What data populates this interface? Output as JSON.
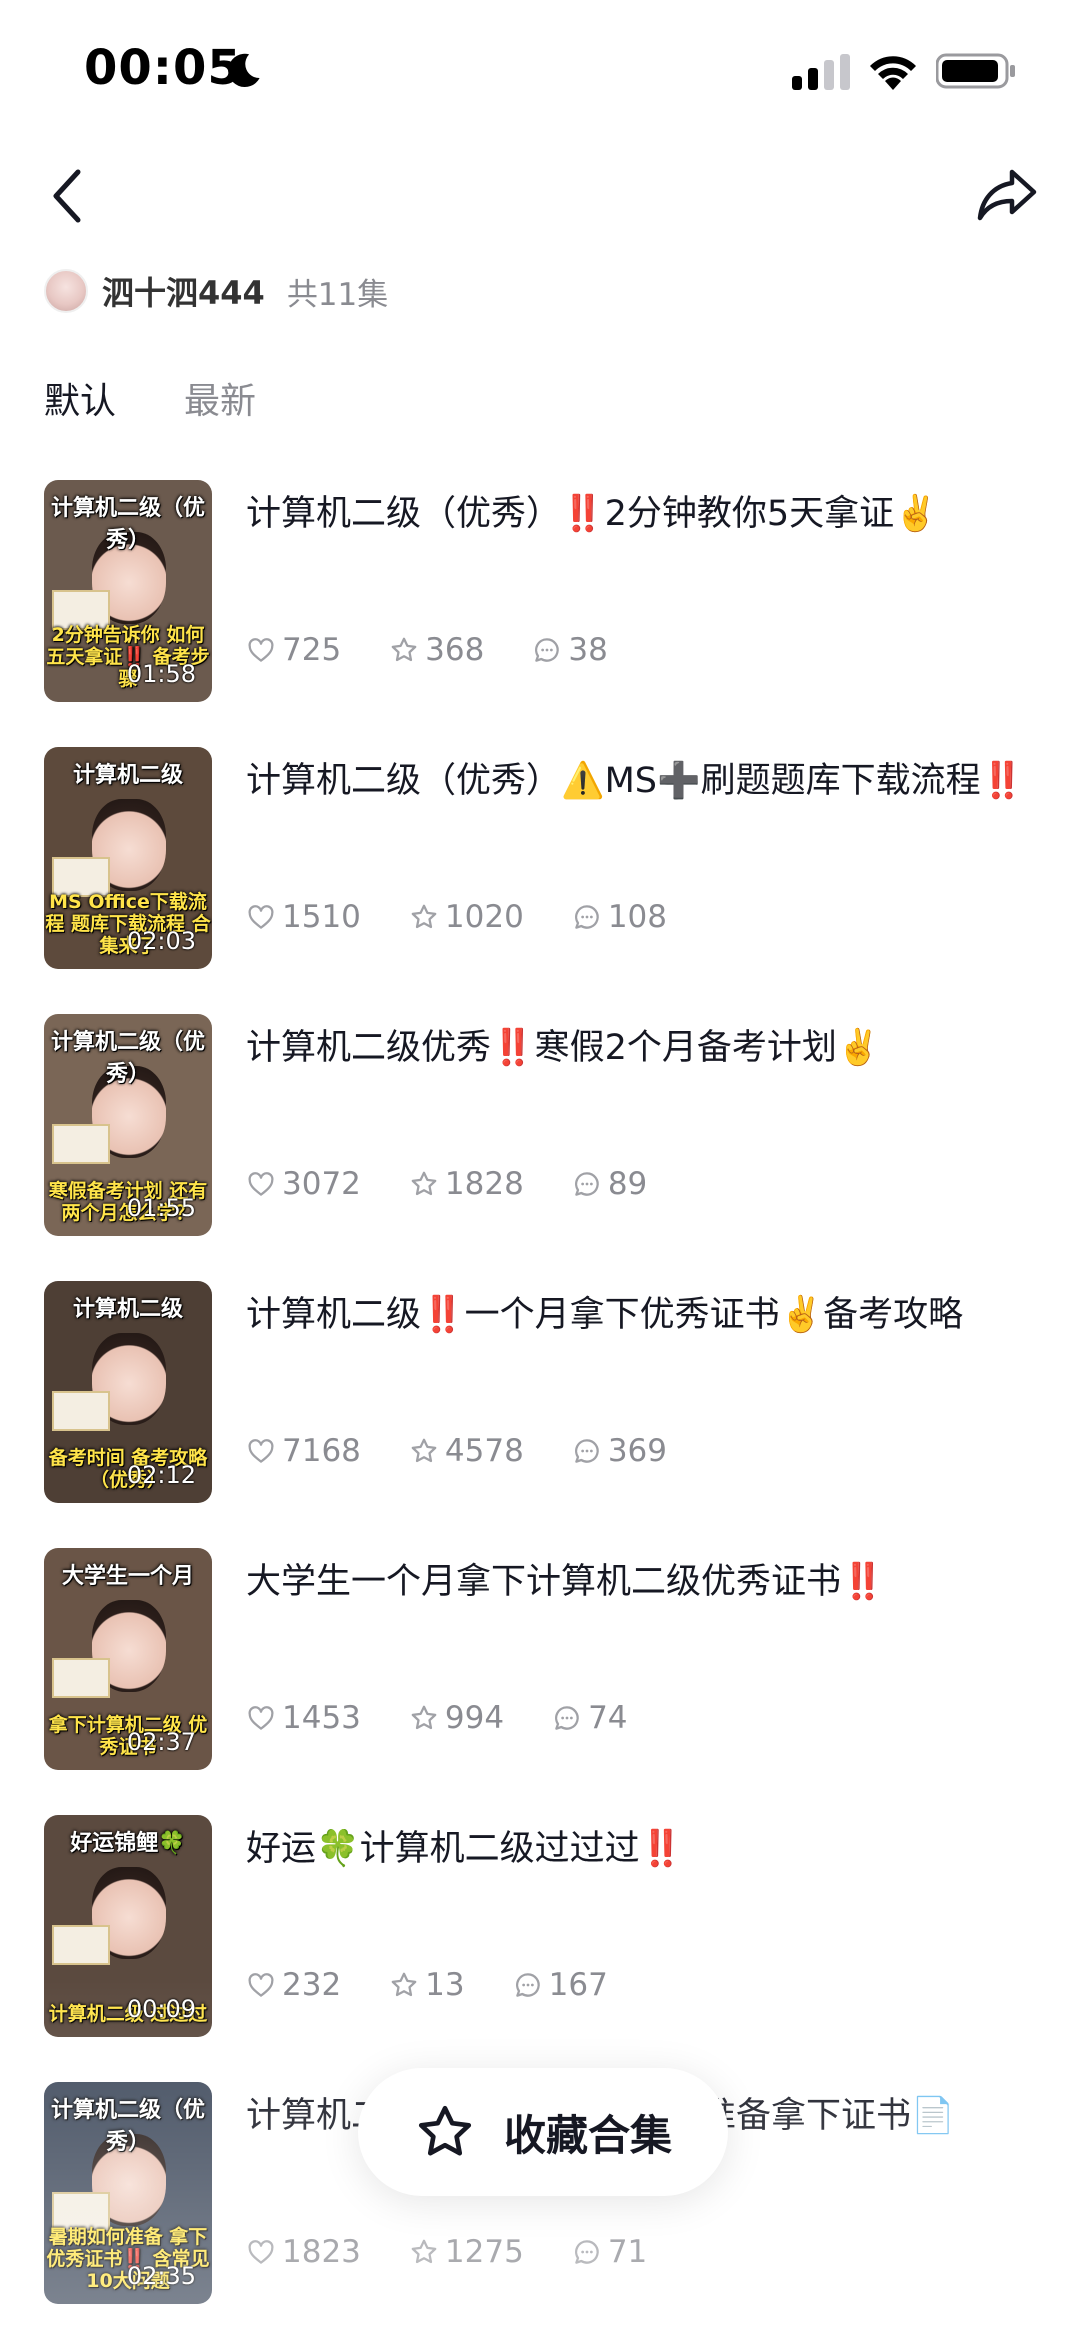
{
  "status_bar": {
    "time": "00:05",
    "icons": [
      "moon-icon",
      "signal-icon",
      "wifi-icon",
      "battery-icon"
    ]
  },
  "nav": {
    "back_icon": "chevron-left-icon",
    "share_icon": "share-arrow-icon"
  },
  "author": {
    "name": "泗十泗444",
    "episode_count": "共11集"
  },
  "tabs": [
    {
      "label": "默认",
      "active": true
    },
    {
      "label": "最新",
      "active": false
    }
  ],
  "items": [
    {
      "title": "计算机二级（优秀）‼️2分钟教你5天拿证✌️",
      "likes": "725",
      "favorites": "368",
      "comments": "38",
      "thumb_top": "计算机二级（优秀）",
      "thumb_bottom": "2分钟告诉你 如何五天拿证‼️ 备考步骤",
      "duration": "01:58",
      "thumb_bg": "#6b5a4e"
    },
    {
      "title": "计算机二级（优秀）⚠️MS➕刷题题库下载流程‼️",
      "likes": "1510",
      "favorites": "1020",
      "comments": "108",
      "thumb_top": "计算机二级",
      "thumb_bottom": "MS Office下载流程 题库下载流程 合集来了",
      "duration": "02:03",
      "thumb_bg": "#5d4a3c"
    },
    {
      "title": "计算机二级优秀‼️寒假2个月备考计划✌️",
      "likes": "3072",
      "favorites": "1828",
      "comments": "89",
      "thumb_top": "计算机二级（优秀）",
      "thumb_bottom": "寒假备考计划 还有两个月怎么学？",
      "duration": "01:55",
      "thumb_bg": "#7a6656"
    },
    {
      "title": "计算机二级‼️一个月拿下优秀证书✌️备考攻略",
      "likes": "7168",
      "favorites": "4578",
      "comments": "369",
      "thumb_top": "计算机二级",
      "thumb_bottom": "备考时间 备考攻略（优秀）",
      "duration": "02:12",
      "thumb_bg": "#4e3f35"
    },
    {
      "title": "大学生一个月拿下计算机二级优秀证书‼️",
      "likes": "1453",
      "favorites": "994",
      "comments": "74",
      "thumb_top": "大学生一个月",
      "thumb_bottom": "拿下计算机二级 优秀证书",
      "duration": "02:37",
      "thumb_bg": "#6a5547"
    },
    {
      "title": "好运🍀计算机二级过过过‼️",
      "likes": "232",
      "favorites": "13",
      "comments": "167",
      "thumb_top": "好运锦鲤🍀",
      "thumb_bottom": "计算机二级 过过过",
      "duration": "00:09",
      "thumb_bg": "#5b4a3f"
    },
    {
      "title": "计算机二级（优秀）暑期如何准备拿下证书📄",
      "likes": "1823",
      "favorites": "1275",
      "comments": "71",
      "thumb_top": "计算机二级（优秀）",
      "thumb_bottom": "暑期如何准备 拿下优秀证书‼️ 含常见10大问题",
      "duration": "02:35",
      "thumb_bg": "#3f4a5c"
    }
  ],
  "collect_button": {
    "label": "收藏合集",
    "icon": "star-icon"
  }
}
